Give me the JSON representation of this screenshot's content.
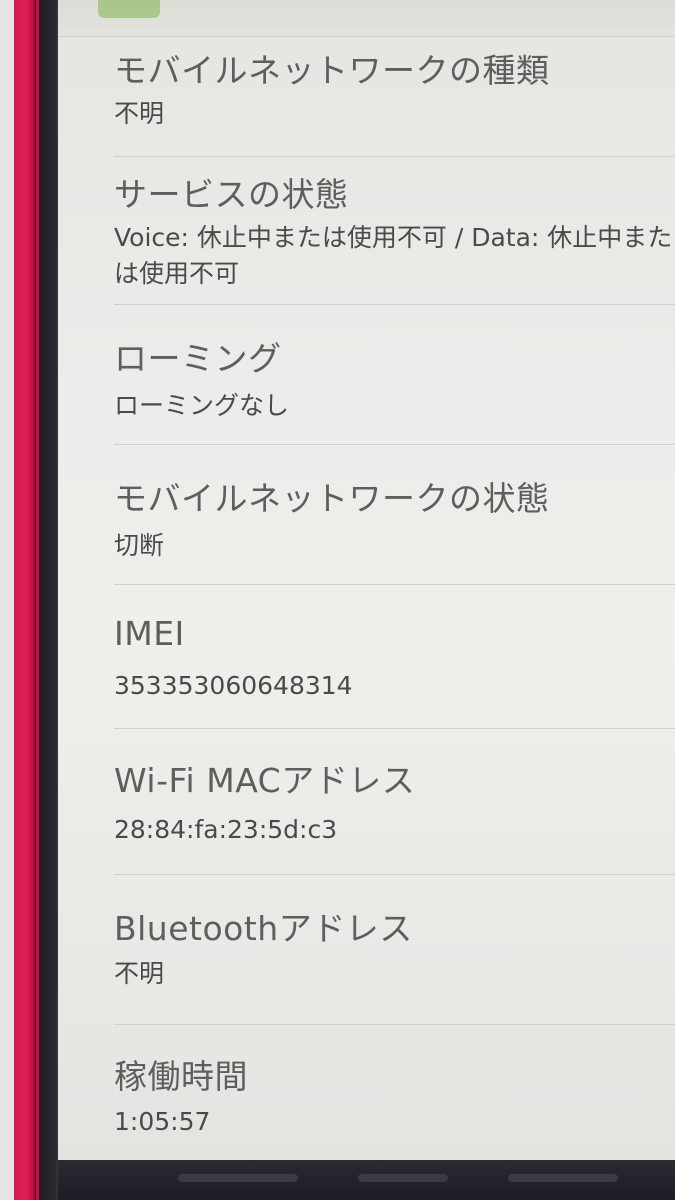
{
  "settings": {
    "items": [
      {
        "title": "モバイルネットワークの種類",
        "summary": "不明"
      },
      {
        "title": "サービスの状態",
        "summary": "Voice: 休止中または使用不可 / Data: 休止中または使用不可"
      },
      {
        "title": "ローミング",
        "summary": "ローミングなし"
      },
      {
        "title": "モバイルネットワークの状態",
        "summary": "切断"
      },
      {
        "title": "IMEI",
        "summary": "353353060648314"
      },
      {
        "title": "Wi-Fi MACアドレス",
        "summary": "28:84:fa:23:5d:c3"
      },
      {
        "title": "Bluetoothアドレス",
        "summary": "不明"
      },
      {
        "title": "稼働時間",
        "summary": "1:05:57"
      }
    ]
  }
}
